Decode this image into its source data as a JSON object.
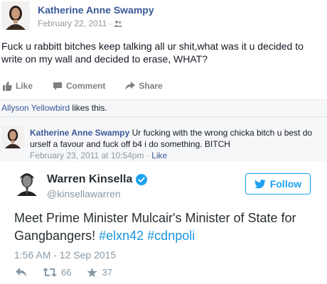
{
  "facebook": {
    "author": "Katherine Anne Swampy",
    "date": "February 22, 2011",
    "separator": "·",
    "post_text": "Fuck u rabbitt bitches keep talking all ur shit,what was it u decided to write on my wall and decided to erase, WHAT?",
    "actions": {
      "like": "Like",
      "comment": "Comment",
      "share": "Share"
    },
    "likes": {
      "name": "Allyson Yellowbird",
      "suffix": " likes this."
    },
    "comment": {
      "author": "Katherine Anne Swampy",
      "text": " Ur fucking with the wrong chicka bitch u best do urself a favour and fuck off b4 i do something. BITCH",
      "date": "February 23, 2011 at 10:54pm",
      "separator": " · ",
      "like": "Like"
    },
    "colors": {
      "link": "#3b5998",
      "meta": "#9197a3",
      "bar": "#f6f7f9"
    }
  },
  "tweet": {
    "name": "Warren Kinsella",
    "handle": "@kinsellawarren",
    "follow_label": "Follow",
    "text_before": "Meet Prime Minister Mulcair's Minister of State for Gangbangers! ",
    "hashtag1": "#elxn42",
    "space": " ",
    "hashtag2": "#cdnpoli",
    "timestamp": "1:56 AM - 12 Sep 2015",
    "retweets": "66",
    "likes": "37",
    "icons": [
      "reply-icon",
      "retweet-icon",
      "star-icon",
      "verified-icon",
      "twitter-bird-icon"
    ],
    "colors": {
      "accent": "#1da1f2",
      "hashtag": "#1b95e0",
      "muted": "#8899a6"
    }
  }
}
